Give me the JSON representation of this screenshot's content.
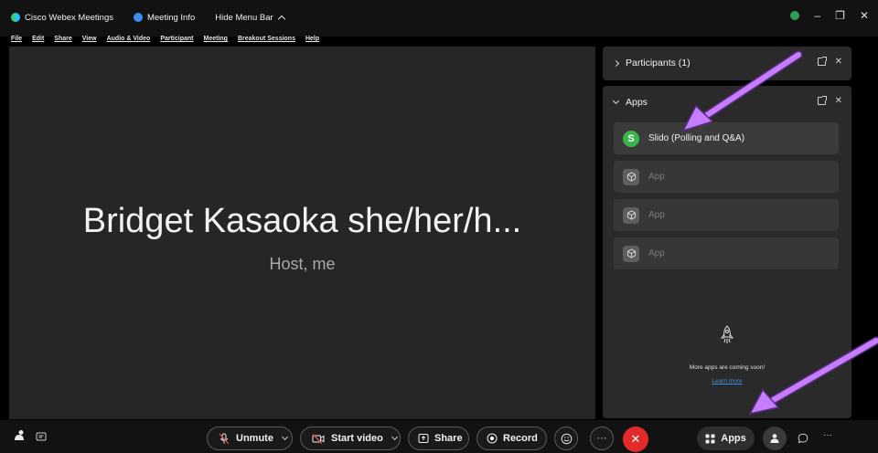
{
  "titlebar": {
    "app_name": "Cisco Webex Meetings",
    "meeting_info": "Meeting Info",
    "hide_menu": "Hide Menu Bar"
  },
  "menu": {
    "items": [
      "File",
      "Edit",
      "Share",
      "View",
      "Audio & Video",
      "Participant",
      "Meeting",
      "Breakout Sessions",
      "Help"
    ]
  },
  "window_controls": {
    "minimize": "–",
    "maximize": "❐",
    "close": "✕"
  },
  "stage": {
    "presenter_name": "Bridget Kasaoka she/her/h...",
    "presenter_role": "Host, me"
  },
  "participants_panel": {
    "title": "Participants (1)"
  },
  "apps_panel": {
    "title": "Apps",
    "items": [
      {
        "label": "Slido (Polling and Q&A)",
        "icon_letter": "S"
      },
      {
        "label": "App"
      },
      {
        "label": "App"
      },
      {
        "label": "App"
      }
    ],
    "coming_soon": "More apps are coming soon!",
    "learn_more": "Learn more"
  },
  "toolbar": {
    "unmute": "Unmute",
    "start_video": "Start video",
    "share": "Share",
    "record": "Record",
    "more": "···",
    "end": "✕",
    "apps": "Apps",
    "overflow": "···"
  },
  "colors": {
    "accent_blue": "#3f8fe8",
    "end_red": "#e22a2a",
    "slido_green": "#38b44a",
    "annotation_arrow": "#c77dff"
  },
  "icons": {
    "titlebar": [
      "webex-logo-icon",
      "info-icon",
      "chevron-up-icon"
    ],
    "toolbar": [
      "self-view-icon",
      "captions-icon",
      "mic-muted-icon",
      "video-off-icon",
      "share-icon",
      "record-icon",
      "reactions-icon",
      "more-icon",
      "end-call-icon",
      "apps-icon",
      "participants-icon",
      "chat-icon"
    ]
  }
}
